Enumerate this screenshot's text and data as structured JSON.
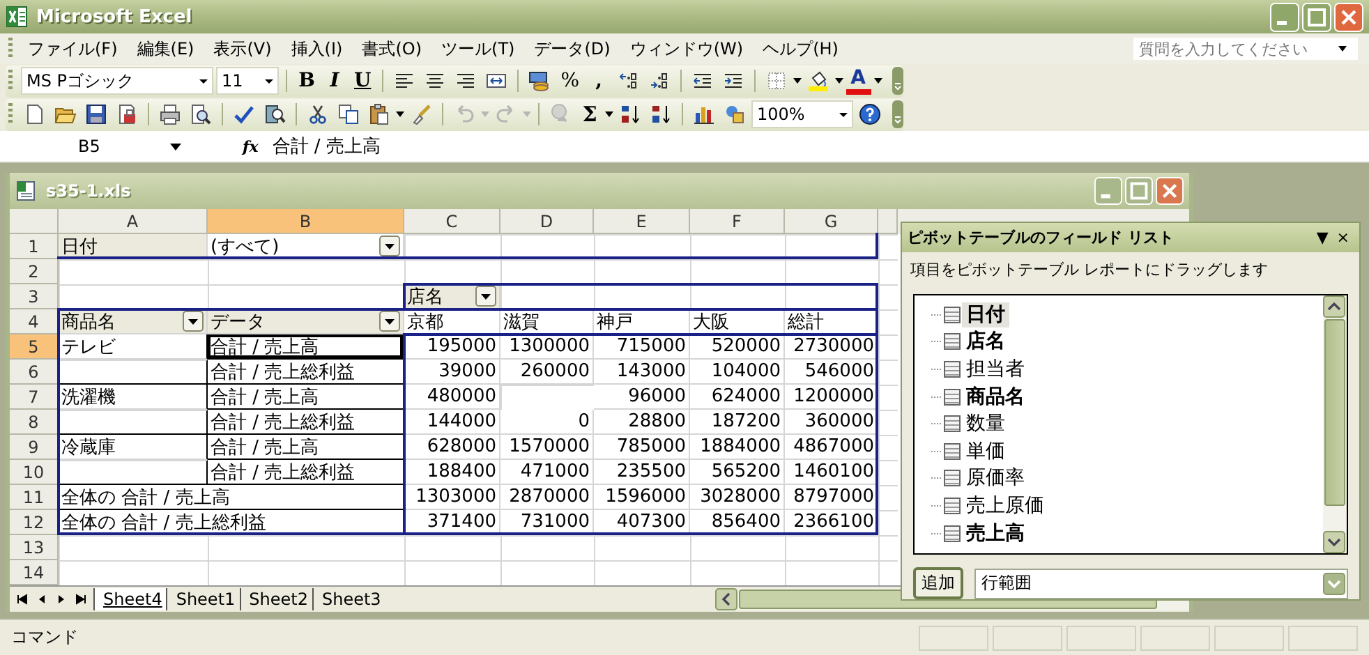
{
  "window": {
    "title": "Microsoft Excel"
  },
  "menu": [
    "ファイル(F)",
    "編集(E)",
    "表示(V)",
    "挿入(I)",
    "書式(O)",
    "ツール(T)",
    "データ(D)",
    "ウィンドウ(W)",
    "ヘルプ(H)"
  ],
  "help_search": {
    "placeholder": "質問を入力してください"
  },
  "formatting_toolbar": {
    "font_name": "MS Pゴシック",
    "font_size": "11",
    "bold": "B",
    "italic": "I",
    "underline": "U",
    "percent": "%",
    "comma": ",",
    "font_color": "A"
  },
  "standard_toolbar": {
    "sum": "Σ",
    "zoom": "100%"
  },
  "formula_bar": {
    "name_box": "B5",
    "function_symbol": "fx",
    "formula": "合計 / 売上高"
  },
  "workbook": {
    "title": "s35-1.xls",
    "columns": [
      {
        "label": "A",
        "selected": false
      },
      {
        "label": "B",
        "selected": true
      },
      {
        "label": "C",
        "selected": false
      },
      {
        "label": "D",
        "selected": false
      },
      {
        "label": "E",
        "selected": false
      },
      {
        "label": "F",
        "selected": false
      },
      {
        "label": "G",
        "selected": false
      }
    ],
    "rows": [
      {
        "number": "1",
        "selected": false,
        "kind": "page",
        "cells": [
          {
            "text": "日付",
            "kind": "field"
          },
          {
            "text": "(すべて)",
            "kind": "dropdown"
          }
        ]
      },
      {
        "number": "2",
        "selected": false,
        "kind": "blank"
      },
      {
        "number": "3",
        "selected": false,
        "kind": "header",
        "cells": [
          null,
          null,
          {
            "text": "店名",
            "kind": "field_dropdown"
          }
        ]
      },
      {
        "number": "4",
        "selected": false,
        "kind": "header",
        "cells": [
          {
            "text": "商品名",
            "kind": "field_dropdown"
          },
          {
            "text": "データ",
            "kind": "field_dropdown"
          },
          "京都",
          "滋賀",
          "神戸",
          "大阪",
          "総計"
        ]
      },
      {
        "number": "5",
        "selected": true,
        "kind": "data",
        "cells": [
          "テレビ",
          "合計 / 売上高",
          "195000",
          "1300000",
          "715000",
          "520000",
          "2730000"
        ]
      },
      {
        "number": "6",
        "selected": false,
        "kind": "data",
        "cells": [
          null,
          "合計 / 売上総利益",
          "39000",
          "260000",
          "143000",
          "104000",
          "546000"
        ]
      },
      {
        "number": "7",
        "selected": false,
        "kind": "data",
        "cells": [
          "洗濯機",
          "合計 / 売上高",
          "480000",
          null,
          "96000",
          "624000",
          "1200000"
        ]
      },
      {
        "number": "8",
        "selected": false,
        "kind": "data",
        "cells": [
          null,
          "合計 / 売上総利益",
          "144000",
          "0",
          "28800",
          "187200",
          "360000"
        ]
      },
      {
        "number": "9",
        "selected": false,
        "kind": "data",
        "cells": [
          "冷蔵庫",
          "合計 / 売上高",
          "628000",
          "1570000",
          "785000",
          "1884000",
          "4867000"
        ]
      },
      {
        "number": "10",
        "selected": false,
        "kind": "data",
        "cells": [
          null,
          "合計 / 売上総利益",
          "188400",
          "471000",
          "235500",
          "565200",
          "1460100"
        ]
      },
      {
        "number": "11",
        "selected": false,
        "kind": "data",
        "cells": [
          {
            "text": "全体の 合計 / 売上高",
            "kind": "total_label"
          },
          null,
          "1303000",
          "2870000",
          "1596000",
          "3028000",
          "8797000"
        ]
      },
      {
        "number": "12",
        "selected": false,
        "kind": "data",
        "cells": [
          {
            "text": "全体の 合計 / 売上総利益",
            "kind": "total_label"
          },
          null,
          "371400",
          "731000",
          "407300",
          "856400",
          "2366100"
        ]
      },
      {
        "number": "13",
        "selected": false,
        "kind": "blank"
      },
      {
        "number": "14",
        "selected": false,
        "kind": "blank"
      }
    ],
    "sheet_tabs": [
      {
        "label": "Sheet4",
        "selected": true
      },
      {
        "label": "Sheet1",
        "selected": false
      },
      {
        "label": "Sheet2",
        "selected": false
      },
      {
        "label": "Sheet3",
        "selected": false
      }
    ]
  },
  "pivot_field_list": {
    "title": "ピボットテーブルのフィールド リスト",
    "menu_arrow": "▼",
    "close": "×",
    "instruction": "項目をピボットテーブル レポートにドラッグします",
    "fields": [
      {
        "label": "日付",
        "bold": true,
        "selected": true
      },
      {
        "label": "店名",
        "bold": true,
        "selected": false
      },
      {
        "label": "担当者",
        "bold": false,
        "selected": false
      },
      {
        "label": "商品名",
        "bold": true,
        "selected": false
      },
      {
        "label": "数量",
        "bold": false,
        "selected": false
      },
      {
        "label": "単価",
        "bold": false,
        "selected": false
      },
      {
        "label": "原価率",
        "bold": false,
        "selected": false
      },
      {
        "label": "売上原価",
        "bold": false,
        "selected": false
      },
      {
        "label": "売上高",
        "bold": true,
        "selected": false
      }
    ],
    "add_button": "追加",
    "area": "行範囲"
  },
  "status_bar": {
    "text": "コマンド"
  }
}
